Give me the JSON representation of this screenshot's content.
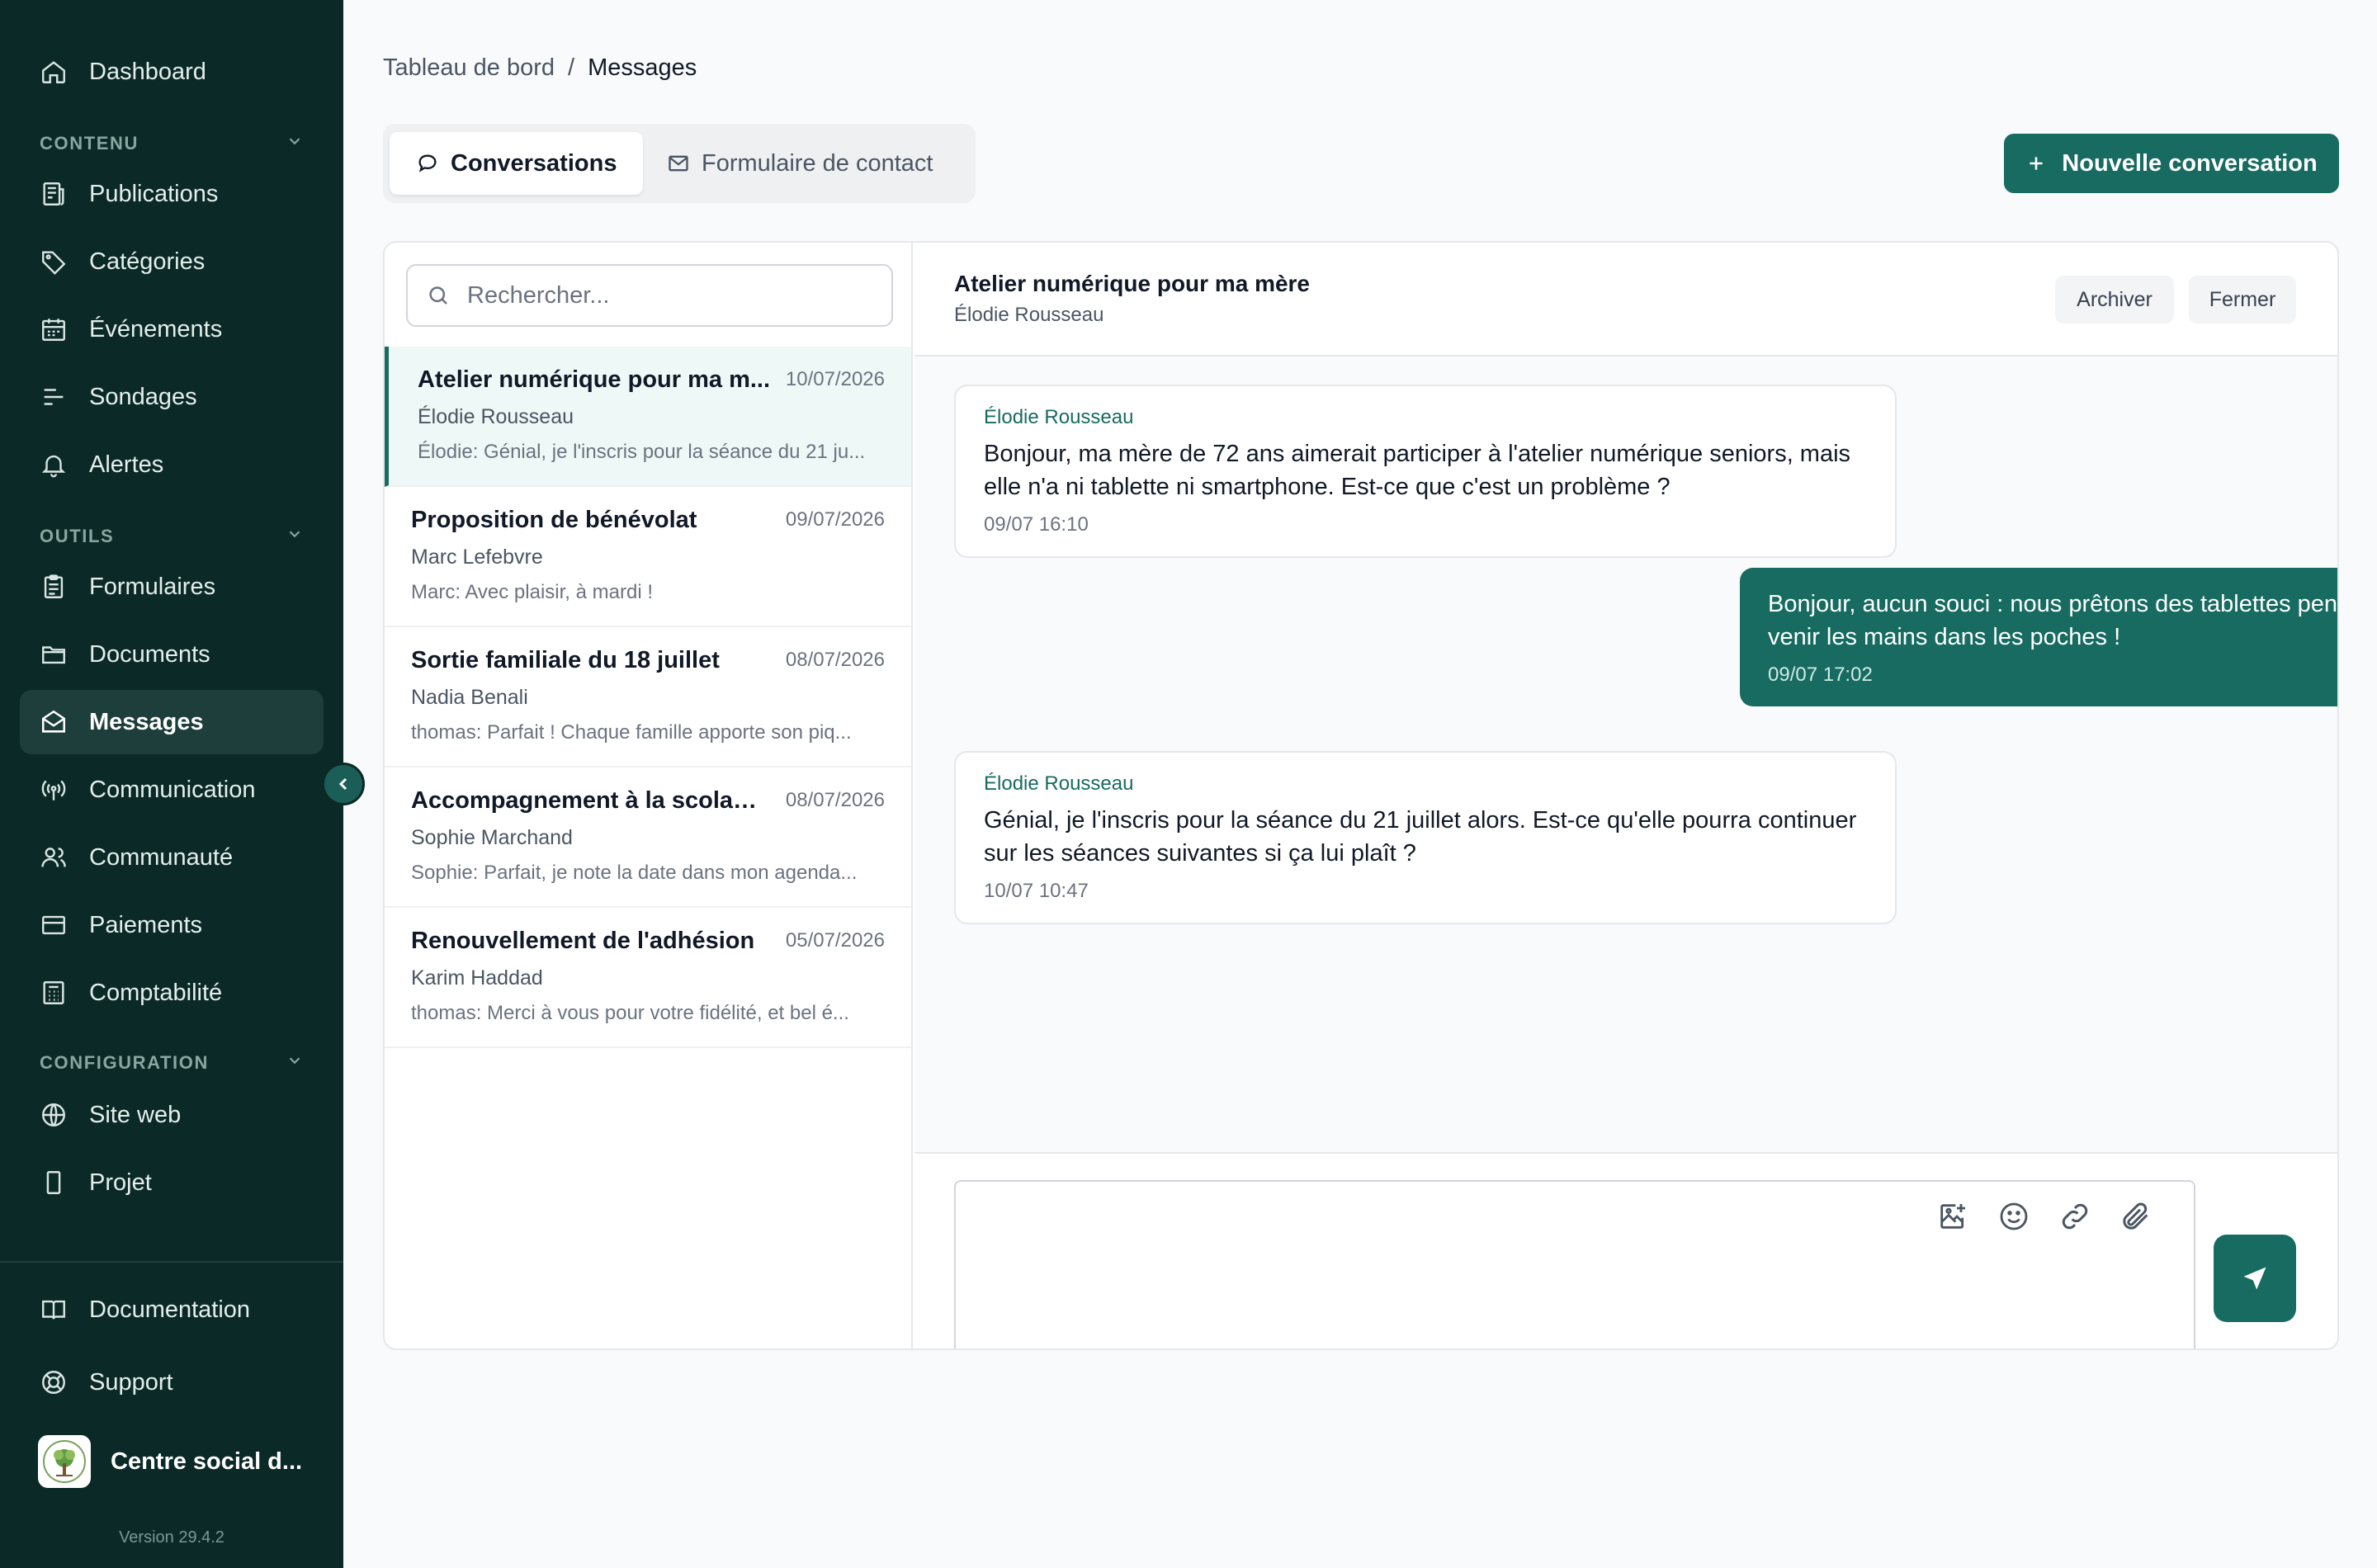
{
  "sidebar": {
    "dashboard": "Dashboard",
    "sections": {
      "contenu": "CONTENU",
      "outils": "OUTILS",
      "configuration": "CONFIGURATION"
    },
    "items": {
      "publications": "Publications",
      "categories": "Catégories",
      "evenements": "Événements",
      "sondages": "Sondages",
      "alertes": "Alertes",
      "formulaires": "Formulaires",
      "documents": "Documents",
      "messages": "Messages",
      "communication": "Communication",
      "communaute": "Communauté",
      "paiements": "Paiements",
      "comptabilite": "Comptabilité",
      "site_web": "Site web",
      "projet": "Projet"
    },
    "footer": {
      "documentation": "Documentation",
      "support": "Support",
      "org_name": "Centre social d...",
      "version": "Version 29.4.2"
    },
    "active_item": "Messages"
  },
  "breadcrumb": {
    "root": "Tableau de bord",
    "separator": "/",
    "current": "Messages"
  },
  "tabs": {
    "conversations": "Conversations",
    "contact_form": "Formulaire de contact",
    "active": "Conversations"
  },
  "actions": {
    "new_conversation": "Nouvelle conversation"
  },
  "search": {
    "placeholder": "Rechercher...",
    "value": ""
  },
  "conversations": [
    {
      "title": "Atelier numérique pour ma m...",
      "date": "10/07/2026",
      "name": "Élodie Rousseau",
      "preview": "Élodie: Génial, je l'inscris pour la séance du 21 ju..."
    },
    {
      "title": "Proposition de bénévolat",
      "date": "09/07/2026",
      "name": "Marc Lefebvre",
      "preview": "Marc: Avec plaisir, à mardi !"
    },
    {
      "title": "Sortie familiale du 18 juillet",
      "date": "08/07/2026",
      "name": "Nadia Benali",
      "preview": "thomas: Parfait ! Chaque famille apporte son piq..."
    },
    {
      "title": "Accompagnement à la scolarité",
      "date": "08/07/2026",
      "name": "Sophie Marchand",
      "preview": "Sophie: Parfait, je note la date dans mon agenda..."
    },
    {
      "title": "Renouvellement de l'adhésion",
      "date": "05/07/2026",
      "name": "Karim Haddad",
      "preview": "thomas: Merci à vous pour votre fidélité, et bel é..."
    }
  ],
  "chat": {
    "title": "Atelier numérique pour ma mère",
    "subtitle": "Élodie Rousseau",
    "archive_label": "Archiver",
    "close_label": "Fermer",
    "messages": [
      {
        "author": "Élodie Rousseau",
        "text": "Bonjour, ma mère de 72 ans aimerait participer à l'atelier numérique seniors, mais elle n'a ni tablette ni smartphone. Est-ce que c'est un problème ?",
        "time": "09/07 16:10",
        "direction": "incoming"
      },
      {
        "author": "",
        "text": "Bonjour, aucun souci : nous prêtons des tablettes pendant les séances. Elle peut venir les mains dans les poches !",
        "time": "09/07 17:02",
        "direction": "outgoing"
      },
      {
        "author": "Élodie Rousseau",
        "text": "Génial, je l'inscris pour la séance du 21 juillet alors. Est-ce qu'elle pourra continuer sur les séances suivantes si ça lui plaît ?",
        "time": "10/07 10:47",
        "direction": "incoming"
      }
    ]
  },
  "composer": {
    "value": "",
    "tools": [
      "image-add-icon",
      "emoji-icon",
      "link-icon",
      "paperclip-icon"
    ],
    "send_icon": "send-icon"
  },
  "colors": {
    "sidebar_bg": "#0b2926",
    "accent": "#176b61",
    "active_row_bg": "#eef8f6"
  }
}
